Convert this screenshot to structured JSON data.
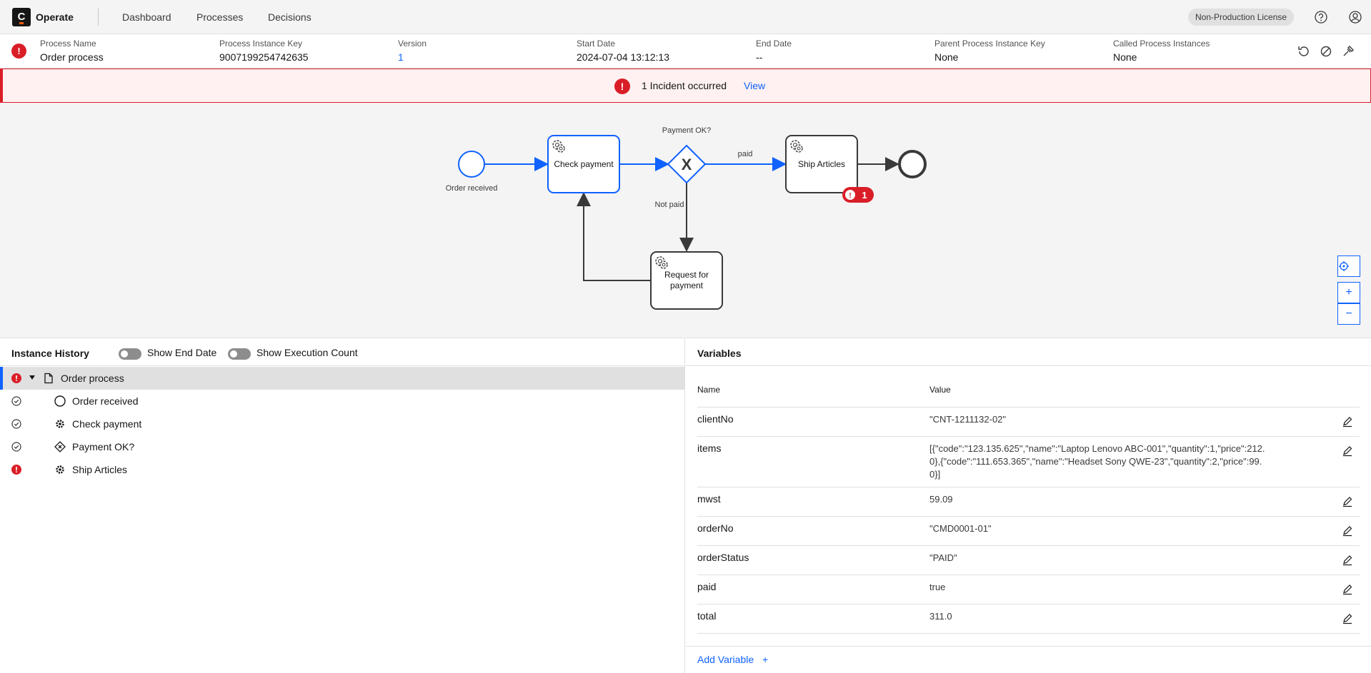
{
  "header": {
    "app_name": "Operate",
    "logo_letter": "C",
    "nav": [
      "Dashboard",
      "Processes",
      "Decisions"
    ],
    "license": "Non-Production License",
    "icons": [
      "help-icon",
      "user-icon"
    ]
  },
  "instance": {
    "fields": [
      {
        "label": "Process Name",
        "value": "Order process"
      },
      {
        "label": "Process Instance Key",
        "value": "9007199254742635"
      },
      {
        "label": "Version",
        "value": "1"
      },
      {
        "label": "Start Date",
        "value": "2024-07-04 13:12:13"
      },
      {
        "label": "End Date",
        "value": "--"
      },
      {
        "label": "Parent Process Instance Key",
        "value": "None"
      },
      {
        "label": "Called Process Instances",
        "value": "None"
      }
    ],
    "state_icon": "!",
    "actions": [
      "retry-icon",
      "cancel-icon",
      "modify-icon"
    ]
  },
  "incident": {
    "text": "1 Incident occurred",
    "link": "View",
    "icon": "!"
  },
  "diagram": {
    "start_label": "Order received",
    "task_check": "Check payment",
    "gateway_label": "Payment OK?",
    "gateway_symbol": "X",
    "flow_paid": "paid",
    "flow_not_paid": "Not paid",
    "task_ship": "Ship Articles",
    "task_request_1": "Request for",
    "task_request_2": "payment",
    "incident_count": "1",
    "incident_mark": "!",
    "zoom_in": "+",
    "zoom_out": "−"
  },
  "history": {
    "title": "Instance History",
    "toggle_end_date": "Show End Date",
    "toggle_exec_count": "Show Execution Count",
    "rows": [
      {
        "label": "Order process",
        "state": "incident",
        "icon": "document-icon"
      },
      {
        "label": "Order received",
        "state": "completed",
        "icon": "start-event-icon"
      },
      {
        "label": "Check payment",
        "state": "completed",
        "icon": "service-task-icon"
      },
      {
        "label": "Payment OK?",
        "state": "completed",
        "icon": "gateway-icon"
      },
      {
        "label": "Ship Articles",
        "state": "incident",
        "icon": "service-task-icon"
      }
    ]
  },
  "variables": {
    "title": "Variables",
    "col_name": "Name",
    "col_value": "Value",
    "rows": [
      {
        "name": "clientNo",
        "value": "\"CNT-1211132-02\""
      },
      {
        "name": "items",
        "value": "[{\"code\":\"123.135.625\",\"name\":\"Laptop Lenovo ABC-001\",\"quantity\":1,\"price\":212.0},{\"code\":\"111.653.365\",\"name\":\"Headset Sony QWE-23\",\"quantity\":2,\"price\":99.0}]"
      },
      {
        "name": "mwst",
        "value": "59.09"
      },
      {
        "name": "orderNo",
        "value": "\"CMD0001-01\""
      },
      {
        "name": "orderStatus",
        "value": "\"PAID\""
      },
      {
        "name": "paid",
        "value": "true"
      },
      {
        "name": "total",
        "value": "311.0"
      }
    ],
    "add_label": "Add Variable",
    "add_icon": "+"
  },
  "colors": {
    "accent": "#0f62fe",
    "incident": "#da1e28",
    "banner_bg": "#fff1f1"
  }
}
